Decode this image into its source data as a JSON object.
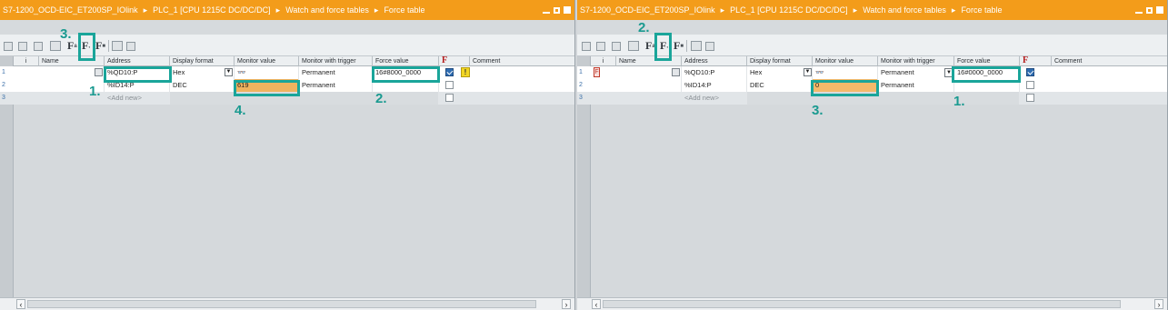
{
  "left": {
    "breadcrumb": {
      "project": "S7-1200_OCD-EIC_ET200SP_IOlink",
      "plc": "PLC_1 [CPU 1215C DC/DC/DC]",
      "folder": "Watch and force tables",
      "table": "Force table"
    },
    "columns": {
      "info": "i",
      "name": "Name",
      "address": "Address",
      "display_format": "Display format",
      "monitor_value": "Monitor value",
      "monitor_trigger": "Monitor with trigger",
      "force_value": "Force value",
      "force_flag": "F",
      "comment": "Comment"
    },
    "rows": [
      {
        "num": "1",
        "address": "%QD10:P",
        "format": "Hex",
        "monitor": "",
        "trigger": "Permanent",
        "force": "16#8000_0000",
        "checked": true
      },
      {
        "num": "2",
        "address": "%ID14:P",
        "format": "DEC",
        "monitor": "619",
        "trigger": "Permanent",
        "force": "",
        "checked": false
      },
      {
        "num": "3",
        "address": "<Add new>"
      }
    ],
    "steps": {
      "s1": "1.",
      "s2": "2.",
      "s3": "3.",
      "s4": "4."
    }
  },
  "right": {
    "breadcrumb": {
      "project": "S7-1200_OCD-EIC_ET200SP_IOlink",
      "plc": "PLC_1 [CPU 1215C DC/DC/DC]",
      "folder": "Watch and force tables",
      "table": "Force table"
    },
    "columns": {
      "info": "i",
      "name": "Name",
      "address": "Address",
      "display_format": "Display format",
      "monitor_value": "Monitor value",
      "monitor_trigger": "Monitor with trigger",
      "force_value": "Force value",
      "force_flag": "F",
      "comment": "Comment"
    },
    "rows": [
      {
        "num": "1",
        "address": "%QD10:P",
        "format": "Hex",
        "monitor": "",
        "trigger": "Permanent",
        "force": "16#0000_0000",
        "checked": true,
        "force_marker": "F"
      },
      {
        "num": "2",
        "address": "%ID14:P",
        "format": "DEC",
        "monitor": "0",
        "trigger": "Permanent",
        "force": "",
        "checked": false
      },
      {
        "num": "3",
        "address": "<Add new>"
      }
    ],
    "steps": {
      "s1": "1.",
      "s2": "2.",
      "s3": "3."
    }
  },
  "toolbar": {
    "force_btn_1": "F",
    "force_btn_2": "F",
    "force_btn_3": "F"
  },
  "icons": {
    "monitor_glasses": "glasses-icon",
    "warning": "warning-icon",
    "dropdown": "chevron-down-icon"
  },
  "colors": {
    "title_bar": "#f39c1a",
    "highlight": "#1aa59a",
    "monitor_value_bg": "#f0b35f"
  }
}
